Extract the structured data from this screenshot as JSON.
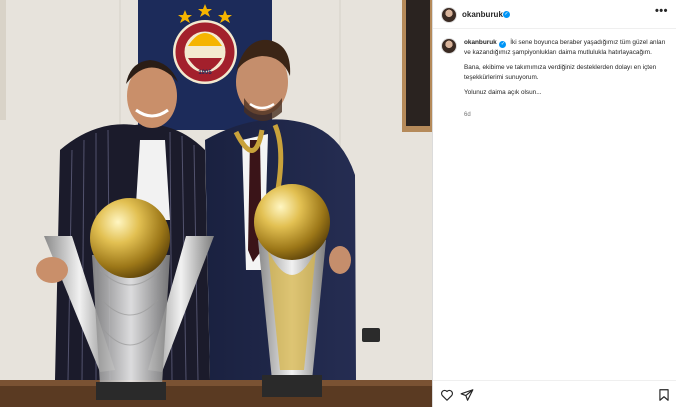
{
  "post": {
    "username": "okanburuk",
    "caption_username": "okanburuk",
    "caption_lines": [
      "İki sene boyunca beraber yaşadığımız tüm güzel anları ve kazandığımız şampiyonlukları daima mutlulukla hatırlayacağım.",
      "Bana, ekibime ve takımımıza verdiğiniz desteklerden dolayı en içten teşekkürlerimi sunuyorum.",
      "Yolunuz daima açık olsun..."
    ],
    "time_ago": "6d"
  },
  "flag": {
    "year": "1905"
  },
  "icons": [
    "heart-icon",
    "share-icon",
    "bookmark-icon",
    "more-options-icon",
    "verified-badge-icon"
  ],
  "colors": {
    "verified": "#0095f6",
    "flag_navy": "#1c2b5a",
    "galatasaray_red": "#a3202c",
    "galatasaray_yellow": "#f5b400",
    "trophy_gold": "#d7b54a"
  }
}
